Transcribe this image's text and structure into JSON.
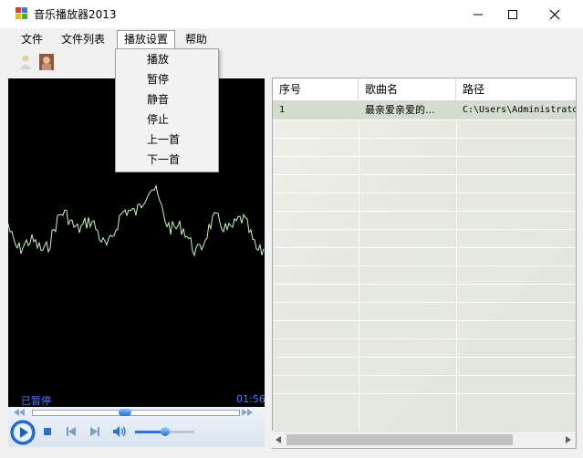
{
  "window": {
    "title": "音乐播放器2013"
  },
  "menubar": {
    "items": [
      {
        "label": "文件"
      },
      {
        "label": "文件列表"
      },
      {
        "label": "播放设置"
      },
      {
        "label": "帮助"
      }
    ]
  },
  "dropdown": {
    "items": [
      {
        "label": "播放"
      },
      {
        "label": "暂停"
      },
      {
        "label": "静音"
      },
      {
        "label": "停止"
      },
      {
        "label": "上一首"
      },
      {
        "label": "下一首"
      }
    ]
  },
  "player": {
    "status": "已暂停",
    "time": "01:56"
  },
  "playlist": {
    "columns": [
      {
        "label": "序号"
      },
      {
        "label": "歌曲名"
      },
      {
        "label": "路径"
      }
    ],
    "rows": [
      {
        "index": "1",
        "name": "最亲爱亲爱的...",
        "path": "C:\\Users\\Administrator"
      }
    ]
  },
  "colors": {
    "wave": "#c8f5c0",
    "status_text": "#4c7dff",
    "accent": "#1e6fd9"
  },
  "icons": [
    "app-icon",
    "minimize-icon",
    "maximize-icon",
    "close-icon",
    "user-icon",
    "image-icon",
    "play-icon",
    "stop-icon",
    "prev-icon",
    "next-icon",
    "volume-icon"
  ]
}
